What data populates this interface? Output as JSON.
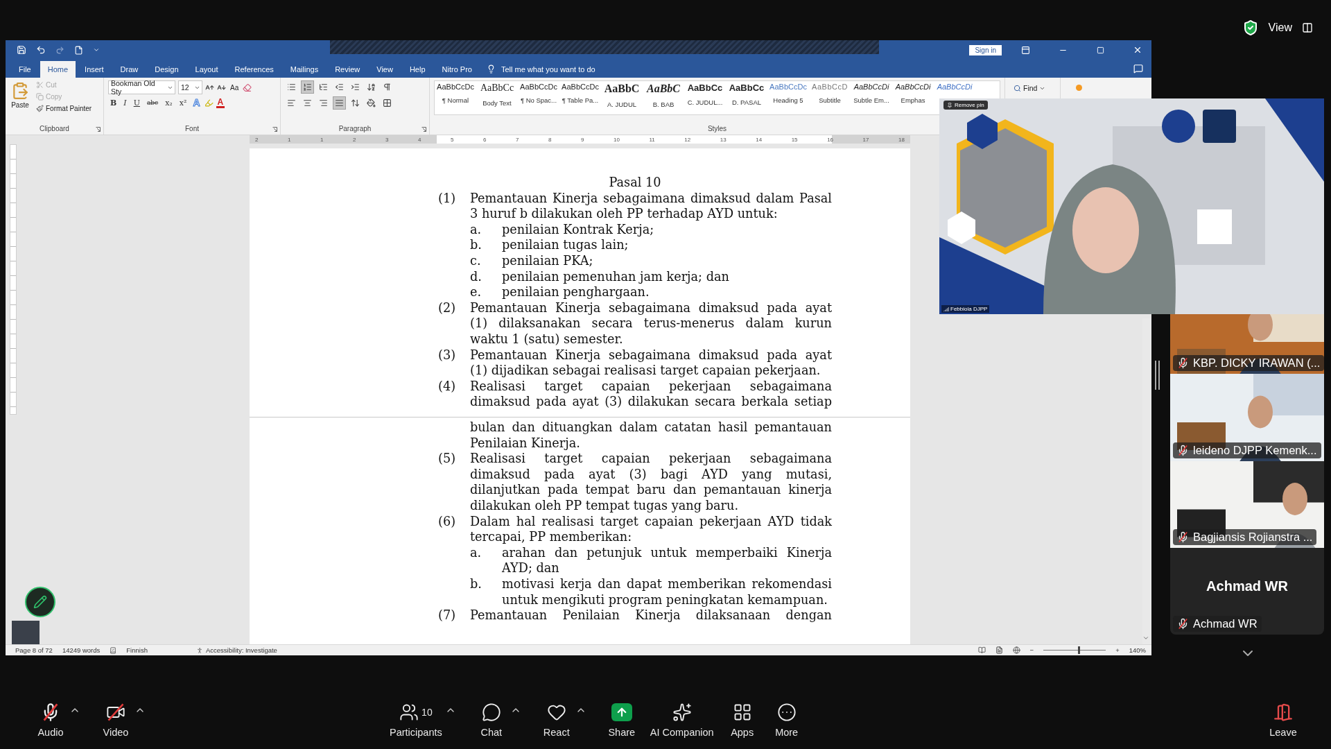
{
  "top_bar": {
    "view_label": "View"
  },
  "word": {
    "tabs": [
      {
        "label": "File",
        "selected": false
      },
      {
        "label": "Home",
        "selected": true
      },
      {
        "label": "Insert",
        "selected": false
      },
      {
        "label": "Draw",
        "selected": false
      },
      {
        "label": "Design",
        "selected": false
      },
      {
        "label": "Layout",
        "selected": false
      },
      {
        "label": "References",
        "selected": false
      },
      {
        "label": "Mailings",
        "selected": false
      },
      {
        "label": "Review",
        "selected": false
      },
      {
        "label": "View",
        "selected": false
      },
      {
        "label": "Help",
        "selected": false
      },
      {
        "label": "Nitro Pro",
        "selected": false
      }
    ],
    "tell_me": "Tell me what you want to do",
    "sign_in": "Sign in",
    "clipboard": {
      "paste": "Paste",
      "group": "Clipboard",
      "actions": [
        {
          "label": "Cut",
          "kind": "cut",
          "disabled": true
        },
        {
          "label": "Copy",
          "kind": "copy",
          "disabled": true
        },
        {
          "label": "Format Painter",
          "kind": "painter",
          "disabled": false
        }
      ]
    },
    "font": {
      "name": "Bookman Old Sty",
      "size": "12",
      "change_case": "Aa",
      "text_effect": "A",
      "font_color": "A",
      "group": "Font",
      "format_buttons": [
        {
          "label": "B",
          "kind": "bold"
        },
        {
          "label": "I",
          "kind": "italic"
        },
        {
          "label": "U",
          "kind": "underline"
        },
        {
          "label": "abc",
          "kind": "strike"
        },
        {
          "label": "x₂",
          "kind": "sub"
        },
        {
          "label": "x²",
          "kind": "sup"
        }
      ]
    },
    "paragraph": {
      "group": "Paragraph",
      "row_1": [
        {
          "kind": "bullets",
          "selected": false
        },
        {
          "kind": "numbering",
          "selected": true
        },
        {
          "kind": "multilevel",
          "selected": false
        },
        {
          "kind": "outdent",
          "selected": false
        },
        {
          "kind": "indent",
          "selected": false
        },
        {
          "kind": "sort",
          "selected": false
        },
        {
          "kind": "marks",
          "selected": false
        }
      ],
      "row_2": [
        {
          "kind": "left",
          "selected": false
        },
        {
          "kind": "center",
          "selected": false
        },
        {
          "kind": "right",
          "selected": false
        },
        {
          "kind": "justify",
          "selected": true
        },
        {
          "kind": "spacing",
          "selected": false
        },
        {
          "kind": "shading",
          "selected": false
        },
        {
          "kind": "borders",
          "selected": false
        }
      ]
    },
    "styles_group": "Styles",
    "styles": [
      {
        "preview": "AaBbCcDc",
        "label": "¶ Normal",
        "kind": "plain"
      },
      {
        "preview": "AaBbCc",
        "label": "Body Text",
        "kind": "body"
      },
      {
        "preview": "AaBbCcDc",
        "label": "¶ No Spac...",
        "kind": "plain"
      },
      {
        "preview": "AaBbCcDc",
        "label": "¶ Table Pa...",
        "kind": "plain"
      },
      {
        "preview": "AaBbC",
        "label": "A. JUDUL",
        "kind": "title"
      },
      {
        "preview": "AaBbC",
        "label": "B. BAB",
        "kind": "title_italic"
      },
      {
        "preview": "AaBbCc",
        "label": "C. JUDUL...",
        "kind": "bold"
      },
      {
        "preview": "AaBbCc",
        "label": "D. PASAL",
        "kind": "bold"
      },
      {
        "preview": "AaBbCcDc",
        "label": "Heading 5",
        "kind": "blue"
      },
      {
        "preview": "AaBbCcD",
        "label": "Subtitle",
        "kind": "grey"
      },
      {
        "preview": "AaBbCcDi",
        "label": "Subtle Em...",
        "kind": "italic"
      },
      {
        "preview": "AaBbCcDi",
        "label": "Emphas",
        "kind": "italic"
      },
      {
        "preview": "AaBbCcDi",
        "kind": "italic_blue"
      }
    ],
    "find": "Find",
    "ruler_numbers": [
      "2",
      "1",
      "1",
      "2",
      "3",
      "4",
      "5",
      "6",
      "7",
      "8",
      "9",
      "10",
      "11",
      "12",
      "13",
      "14",
      "15",
      "16",
      "17",
      "18"
    ],
    "page_1": {
      "heading": "Pasal 10",
      "items": [
        {
          "number": "(1)",
          "text": "Pemantauan Kinerja sebagaimana dimaksud dalam Pasal 3 huruf b dilakukan oleh PP terhadap AYD untuk:",
          "subitems": [
            {
              "letter": "a.",
              "text": "penilaian Kontrak Kerja;"
            },
            {
              "letter": "b.",
              "text": "penilaian tugas lain;"
            },
            {
              "letter": "c.",
              "text": "penilaian PKA;"
            },
            {
              "letter": "d.",
              "text": "penilaian pemenuhan jam kerja; dan"
            },
            {
              "letter": "e.",
              "text": "penilaian penghargaan."
            }
          ]
        },
        {
          "number": "(2)",
          "text": "Pemantauan Kinerja sebagaimana dimaksud pada ayat (1) dilaksanakan secara terus-menerus dalam kurun waktu 1 (satu) semester."
        },
        {
          "number": "(3)",
          "text": "Pemantauan Kinerja sebagaimana dimaksud pada ayat (1) dijadikan sebagai realisasi target capaian pekerjaan."
        },
        {
          "number": "(4)",
          "text": "Realisasi target capaian pekerjaan sebagaimana dimaksud pada ayat (3) dilakukan secara berkala setiap"
        }
      ]
    },
    "page_2": {
      "items": [
        {
          "text": "bulan dan dituangkan dalam catatan hasil pemantauan Penilaian Kinerja."
        },
        {
          "number": "(5)",
          "text": "Realisasi target capaian pekerjaan sebagaimana dimaksud pada ayat (3) bagi AYD yang mutasi, dilanjutkan pada tempat baru dan pemantauan kinerja dilakukan oleh PP tempat tugas yang baru."
        },
        {
          "number": "(6)",
          "text": "Dalam hal realisasi target capaian pekerjaan AYD tidak tercapai, PP memberikan:",
          "subitems": [
            {
              "letter": "a.",
              "text": "arahan dan petunjuk untuk memperbaiki Kinerja AYD; dan"
            },
            {
              "letter": "b.",
              "text": "motivasi kerja dan dapat memberikan rekomendasi untuk mengikuti program peningkatan kemampuan."
            }
          ]
        },
        {
          "number": "(7)",
          "text": "Pemantauan Penilaian Kinerja dilaksanaan dengan"
        }
      ]
    },
    "status": {
      "page": "Page 8 of 72",
      "words": "14249 words",
      "language": "Finnish",
      "accessibility": "Accessibility: Investigate",
      "zoom_out": "−",
      "zoom_in": "+",
      "zoom": "140%",
      "level": 0.55
    }
  },
  "pinned_video": {
    "remove_pin": "Remove pin",
    "name": "Febbiola DJPP"
  },
  "gallery": [
    {
      "kind": "video",
      "name": "KBP. DICKY IRAWAN (...",
      "muted": true
    },
    {
      "kind": "video",
      "name": "leideno DJPP Kemenk...",
      "muted": true
    },
    {
      "kind": "video",
      "name": "Bagjiansis Rojianstra ...",
      "muted": true
    },
    {
      "kind": "avatar",
      "display_name": "Achmad WR",
      "name": "Achmad WR",
      "muted": true
    }
  ],
  "toolbar": [
    {
      "kind": "audio",
      "label": "Audio",
      "muted": true,
      "caret": true
    },
    {
      "kind": "video",
      "label": "Video",
      "muted": true,
      "caret": true
    },
    {
      "kind": "participants",
      "label": "Participants",
      "count": "10",
      "caret": true
    },
    {
      "kind": "chat",
      "label": "Chat",
      "caret": true
    },
    {
      "kind": "react",
      "label": "React",
      "caret": true
    },
    {
      "kind": "share",
      "label": "Share",
      "caret": false
    },
    {
      "kind": "ai",
      "label": "AI Companion",
      "caret": false
    },
    {
      "kind": "apps",
      "label": "Apps",
      "caret": false
    },
    {
      "kind": "more",
      "label": "More",
      "caret": false
    }
  ],
  "leave": "Leave"
}
